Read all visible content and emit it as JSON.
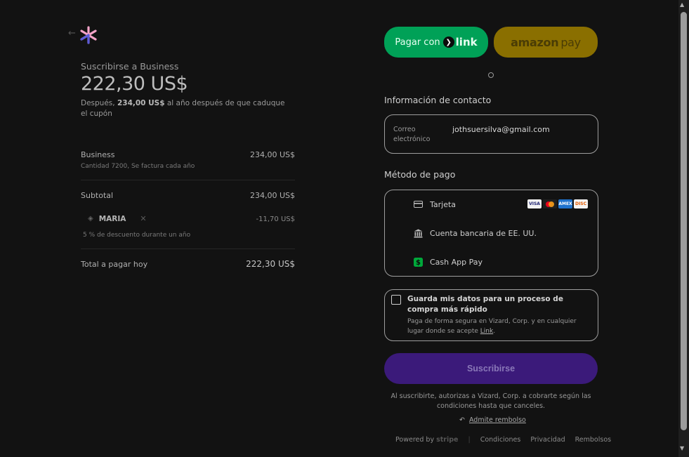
{
  "summary": {
    "back_glyph": "←",
    "subtitle": "Suscribirse a Business",
    "price": "222,30 US$",
    "note_prefix": "Después, ",
    "note_amount": "234,00 US$",
    "note_suffix": " al año después de que caduque el cupón",
    "line_item": {
      "name": "Business",
      "detail": "Cantidad 7200, Se factura cada año",
      "amount": "234,00 US$"
    },
    "subtotal_label": "Subtotal",
    "subtotal_amount": "234,00 US$",
    "coupon": {
      "code": "MARIA",
      "discount": "-11,70 US$",
      "detail": "5 % de descuento durante un año"
    },
    "total_label": "Total a pagar hoy",
    "total_amount": "222,30 US$"
  },
  "express": {
    "link_prefix": "Pagar con",
    "link_word": "link",
    "amazon_word": "amazon",
    "amazon_pay": "pay"
  },
  "contact": {
    "title": "Información de contacto",
    "email_label": "Correo electrónico",
    "email_value": "jothsuersilva@gmail.com"
  },
  "payment": {
    "title": "Método de pago",
    "methods": [
      {
        "label": "Tarjeta",
        "icon": "card-icon"
      },
      {
        "label": "Cuenta bancaria de EE. UU.",
        "icon": "bank-icon"
      },
      {
        "label": "Cash App Pay",
        "icon": "cash-app-icon"
      }
    ],
    "card_brands": [
      "VISA",
      "MC",
      "AMEX",
      "DISC"
    ]
  },
  "save": {
    "title": "Guarda mis datos para un proceso de compra más rápido",
    "desc_prefix": "Paga de forma segura en Vizard, Corp. y en cualquier lugar donde se acepte ",
    "desc_link": "Link",
    "desc_suffix": "."
  },
  "subscribe_label": "Suscribirse",
  "terms": "Al suscribirte, autorizas a Vizard, Corp. a cobrarte según las condiciones hasta que canceles.",
  "refund_label": "Admite rembolso",
  "footer": {
    "powered_by": "Powered by",
    "stripe": "stripe",
    "links": [
      "Condiciones",
      "Privacidad",
      "Rembolsos"
    ]
  },
  "colors": {
    "link_green": "#00a157",
    "amazon_gold": "#8a6f00",
    "subscribe_purple": "#3b1a7a",
    "logo_pink": "#f4a3c8",
    "logo_blue": "#5a5ad8"
  }
}
